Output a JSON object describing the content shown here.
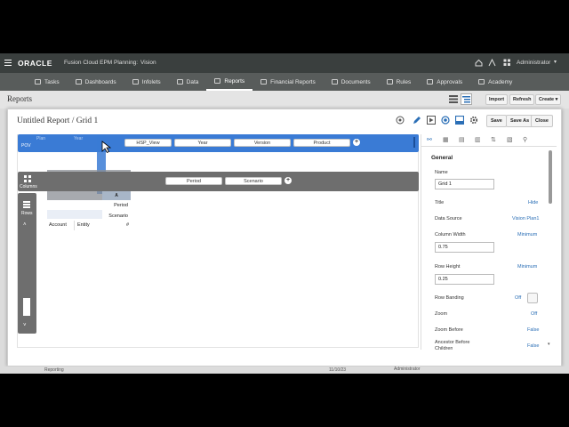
{
  "app": {
    "brand": "ORACLE",
    "product": "Fusion Cloud EPM Planning:",
    "app_name": "Vision",
    "user": "Administrator"
  },
  "nav": {
    "tabs": [
      {
        "label": "Tasks"
      },
      {
        "label": "Dashboards"
      },
      {
        "label": "Infolets"
      },
      {
        "label": "Data"
      },
      {
        "label": "Reports"
      },
      {
        "label": "Financial Reports"
      },
      {
        "label": "Documents"
      },
      {
        "label": "Rules"
      },
      {
        "label": "Approvals"
      },
      {
        "label": "Academy"
      }
    ]
  },
  "subbar": {
    "title": "Reports",
    "import_label": "Import",
    "refresh_label": "Refresh",
    "create_label": "Create"
  },
  "dialog": {
    "title": "Untitled Report / Grid 1",
    "save_label": "Save",
    "save_as_label": "Save As",
    "close_label": "Close",
    "pov": {
      "label": "POV",
      "ghost_labels": [
        "Plan",
        "Year"
      ],
      "chips": [
        "HSP_View",
        "Year",
        "Version",
        "Product"
      ]
    },
    "columns": {
      "label": "Columns",
      "chips": [
        "Period",
        "Scenario"
      ]
    },
    "rows": {
      "label": "Rows"
    },
    "grid": {
      "col_header": "A",
      "col_dims": [
        "Period",
        "Scenario"
      ],
      "row_dims": [
        "Account",
        "Entity"
      ],
      "data_marker": "#"
    }
  },
  "properties": {
    "section": "General",
    "name_label": "Name",
    "name_value": "Grid 1",
    "title_label": "Title",
    "title_value": "Hide",
    "datasource_label": "Data Source",
    "datasource_value": "Vision Plan1",
    "colwidth_label": "Column Width",
    "colwidth_value": "Minimum",
    "colwidth_input": "0.75",
    "rowheight_label": "Row Height",
    "rowheight_value": "Minimum",
    "rowheight_input": "0.25",
    "banding_label": "Row Banding",
    "banding_value": "Off",
    "zoom_label": "Zoom",
    "zoom_value": "Off",
    "zoombefore_label": "Zoom Before",
    "zoombefore_value": "False",
    "ancestor_label": "Ancestor Before",
    "ancestor_label2": "Children",
    "ancestor_value": "False"
  },
  "bottom": {
    "left_text": "Reporting",
    "mid_text": "11/10/23",
    "right_text": "Administrator"
  },
  "colors": {
    "accent_blue": "#3a7bd5",
    "nav_bg": "#585c5b",
    "top_bg": "#3a3f3e",
    "gray_bar": "#6e6e6e"
  }
}
